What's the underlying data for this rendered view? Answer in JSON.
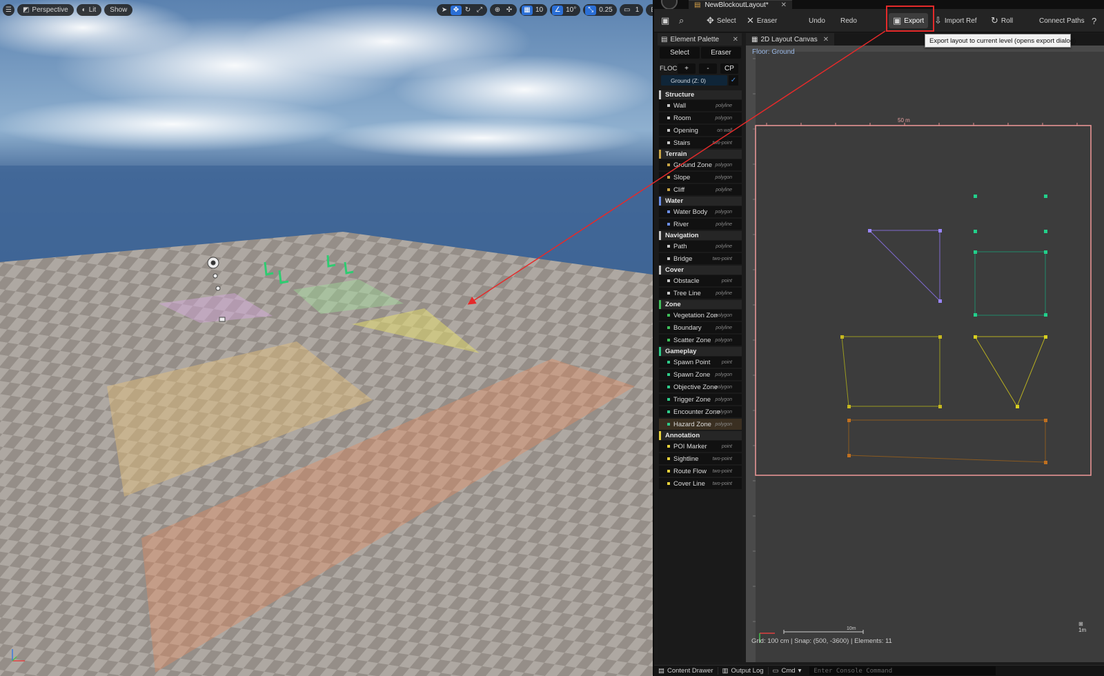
{
  "viewport": {
    "menu_icon": "hamburger-icon",
    "view_mode": "Perspective",
    "lighting": "Lit",
    "show": "Show",
    "grid_snap": "10",
    "rotation_snap": "10°",
    "scale_snap": "0.25",
    "camera_speed": "1"
  },
  "editor": {
    "document_tab": "NewBlockoutLayout*",
    "toolbar": {
      "select": "Select",
      "eraser": "Eraser",
      "undo": "Undo",
      "redo": "Redo",
      "export": "Export",
      "import_ref": "Import Ref",
      "roll": "Roll",
      "connect_paths": "Connect Paths",
      "help": "?"
    },
    "tooltip": "Export layout to current level (opens export dialog)",
    "highlight_color": "#e52a2a"
  },
  "palette": {
    "tab_title": "Element Palette",
    "select": "Select",
    "eraser": "Eraser",
    "floor_label": "FLOC",
    "floor_add": "+",
    "floor_remove": "-",
    "floor_cp": "CP",
    "floor_selected": "Ground  (Z: 0)",
    "categories": [
      {
        "name": "Structure",
        "color": "#c8c8c8",
        "items": [
          {
            "name": "Wall",
            "hint": "polyline"
          },
          {
            "name": "Room",
            "hint": "polygon"
          },
          {
            "name": "Opening",
            "hint": "on wall"
          },
          {
            "name": "Stairs",
            "hint": "two-point"
          }
        ]
      },
      {
        "name": "Terrain",
        "color": "#c9a545",
        "items": [
          {
            "name": "Ground Zone",
            "hint": "polygon"
          },
          {
            "name": "Slope",
            "hint": "polygon"
          },
          {
            "name": "Cliff",
            "hint": "polyline"
          }
        ]
      },
      {
        "name": "Water",
        "color": "#6b8fe8",
        "items": [
          {
            "name": "Water Body",
            "hint": "polygon"
          },
          {
            "name": "River",
            "hint": "polyline"
          }
        ]
      },
      {
        "name": "Navigation",
        "color": "#c8c8c8",
        "items": [
          {
            "name": "Path",
            "hint": "polyline"
          },
          {
            "name": "Bridge",
            "hint": "two-point"
          }
        ]
      },
      {
        "name": "Cover",
        "color": "#c8c8c8",
        "items": [
          {
            "name": "Obstacle",
            "hint": "point"
          },
          {
            "name": "Tree Line",
            "hint": "polyline"
          }
        ]
      },
      {
        "name": "Zone",
        "color": "#3fbf5a",
        "items": [
          {
            "name": "Vegetation Zon",
            "hint": "polygon"
          },
          {
            "name": "Boundary",
            "hint": "polyline"
          },
          {
            "name": "Scatter Zone",
            "hint": "polygon"
          }
        ]
      },
      {
        "name": "Gameplay",
        "color": "#2ecc8a",
        "items": [
          {
            "name": "Spawn Point",
            "hint": "point"
          },
          {
            "name": "Spawn Zone",
            "hint": "polygon"
          },
          {
            "name": "Objective Zone",
            "hint": "polygon"
          },
          {
            "name": "Trigger Zone",
            "hint": "polygon"
          },
          {
            "name": "Encounter Zone",
            "hint": "polygon"
          },
          {
            "name": "Hazard Zone",
            "hint": "polygon",
            "selected": true
          }
        ]
      },
      {
        "name": "Annotation",
        "color": "#e8d23a",
        "items": [
          {
            "name": "POI Marker",
            "hint": "point"
          },
          {
            "name": "Sightline",
            "hint": "two-point"
          },
          {
            "name": "Route Flow",
            "hint": "two-point"
          },
          {
            "name": "Cover Line",
            "hint": "two-point"
          }
        ]
      }
    ]
  },
  "canvas": {
    "tab_title": "2D Layout Canvas",
    "floor_label": "Floor: Ground",
    "top_ruler_label": "50 m",
    "status": "Grid: 100 cm  |  Snap: (500, -3600)  |  Elements: 11",
    "scale_label": "10m",
    "corner_label": "1m"
  },
  "bottom": {
    "content_drawer": "Content Drawer",
    "output_log": "Output Log",
    "cmd": "Cmd",
    "console_placeholder": "Enter Console Command"
  }
}
